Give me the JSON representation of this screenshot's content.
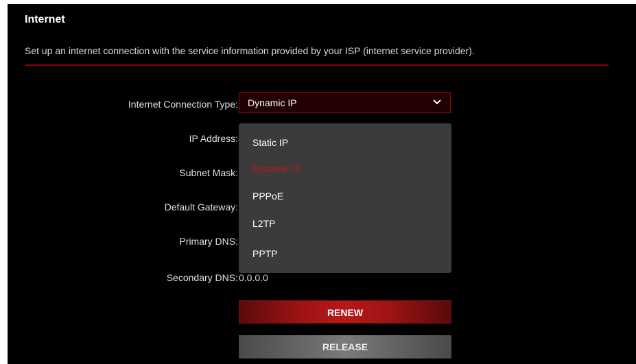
{
  "section": {
    "title": "Internet",
    "description": "Set up an internet connection with the service information provided by your ISP (internet service provider)."
  },
  "form": {
    "connection_type_label": "Internet Connection Type:",
    "connection_type_value": "Dynamic IP",
    "ip_address_label": "IP Address:",
    "subnet_mask_label": "Subnet Mask:",
    "default_gateway_label": "Default Gateway:",
    "primary_dns_label": "Primary DNS:",
    "secondary_dns_label": "Secondary DNS:",
    "secondary_dns_value": "0.0.0.0"
  },
  "dropdown": {
    "options": [
      "Static IP",
      "Dynamic IP",
      "PPPoE",
      "L2TP",
      "PPTP"
    ],
    "selected": "Dynamic IP"
  },
  "buttons": {
    "renew_label": "RENEW",
    "release_label": "RELEASE"
  },
  "colors": {
    "accent": "#c4141c",
    "background": "#000000",
    "dropdown_bg": "#3b3b3b"
  },
  "icons": {
    "select_chevron": "chevron-down-icon"
  }
}
